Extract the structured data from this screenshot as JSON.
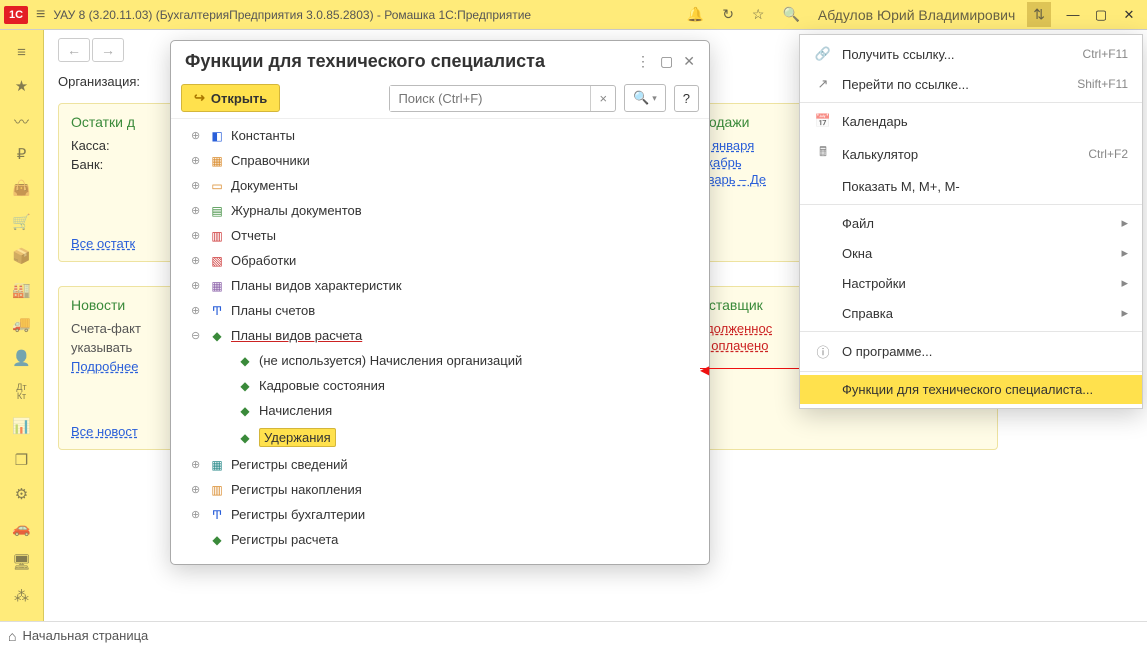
{
  "titlebar": {
    "logo_text": "1C",
    "title": "УАУ 8 (3.20.11.03) (БухгалтерияПредприятия 3.0.85.2803) - Ромашка 1С:Предприятие",
    "user": "Абдулов Юрий Владимирович"
  },
  "main": {
    "org_label": "Организация:",
    "panel_balances": {
      "title": "Остатки д",
      "kassa_label": "Касса:",
      "bank_label": "Банк:",
      "link_all": "Все остатк"
    },
    "panel_news": {
      "title": "Новости",
      "line1": "Счета-факт",
      "line2": "указывать",
      "link_more": "Подробнее",
      "link_all": "Все новост"
    },
    "panel_sales": {
      "title": "Продажи",
      "links": [
        "с 1 января",
        "Декабрь",
        "Январь – Де"
      ]
    },
    "panel_suppliers": {
      "title": "Поставщик",
      "links": [
        "Задолженнос",
        "Не оплачено"
      ]
    }
  },
  "bottombar": {
    "label": "Начальная страница"
  },
  "dialog": {
    "title": "Функции для технического специалиста",
    "btn_open": "Открыть",
    "search_placeholder": "Поиск (Ctrl+F)",
    "help": "?",
    "tree": [
      {
        "icon": "◧",
        "iconClass": "ic-blue",
        "exp": "+",
        "label": "Константы"
      },
      {
        "icon": "▦",
        "iconClass": "ic-orange",
        "exp": "+",
        "label": "Справочники"
      },
      {
        "icon": "▭",
        "iconClass": "ic-orange",
        "exp": "+",
        "label": "Документы"
      },
      {
        "icon": "▤",
        "iconClass": "ic-green",
        "exp": "+",
        "label": "Журналы документов"
      },
      {
        "icon": "▥",
        "iconClass": "ic-red",
        "exp": "+",
        "label": "Отчеты"
      },
      {
        "icon": "▧",
        "iconClass": "ic-red",
        "exp": "+",
        "label": "Обработки"
      },
      {
        "icon": "▦",
        "iconClass": "ic-purple",
        "exp": "+",
        "label": "Планы видов характеристик"
      },
      {
        "icon": "Ͳ",
        "iconClass": "ic-blue",
        "exp": "+",
        "label": "Планы счетов"
      },
      {
        "icon": "◆",
        "iconClass": "ic-green",
        "exp": "–",
        "label": "Планы видов расчета",
        "underline": true
      },
      {
        "icon": "◆",
        "iconClass": "ic-green",
        "indent": 1,
        "label": "(не используется) Начисления организаций"
      },
      {
        "icon": "◆",
        "iconClass": "ic-green",
        "indent": 1,
        "label": "Кадровые состояния"
      },
      {
        "icon": "◆",
        "iconClass": "ic-green",
        "indent": 1,
        "label": "Начисления"
      },
      {
        "icon": "◆",
        "iconClass": "ic-green",
        "indent": 1,
        "label": "Удержания",
        "selected": true
      },
      {
        "icon": "▦",
        "iconClass": "ic-teal",
        "exp": "+",
        "label": "Регистры сведений"
      },
      {
        "icon": "▥",
        "iconClass": "ic-orange",
        "exp": "+",
        "label": "Регистры накопления"
      },
      {
        "icon": "Ͳ",
        "iconClass": "ic-blue",
        "exp": "+",
        "label": "Регистры бухгалтерии"
      },
      {
        "icon": "◆",
        "iconClass": "ic-green",
        "exp": " ",
        "label": "Регистры расчета"
      }
    ]
  },
  "menu": {
    "items": [
      {
        "icon": "🔗",
        "label": "Получить ссылку...",
        "hint": "Ctrl+F11"
      },
      {
        "icon": "↗",
        "label": "Перейти по ссылке...",
        "hint": "Shift+F11"
      },
      {
        "sep": true
      },
      {
        "icon": "📅",
        "label": "Календарь"
      },
      {
        "icon": "🖩",
        "label": "Калькулятор",
        "hint": "Ctrl+F2"
      },
      {
        "icon": "",
        "label": "Показать M, M+, M-"
      },
      {
        "sep": true
      },
      {
        "icon": "",
        "label": "Файл",
        "arrow": true
      },
      {
        "icon": "",
        "label": "Окна",
        "arrow": true
      },
      {
        "icon": "",
        "label": "Настройки",
        "arrow": true
      },
      {
        "icon": "",
        "label": "Справка",
        "arrow": true
      },
      {
        "sep": true
      },
      {
        "icon": "ⓘ",
        "label": "О программе..."
      },
      {
        "sep": true
      },
      {
        "icon": "",
        "label": "Функции для технического специалиста...",
        "highlight": true
      }
    ]
  }
}
